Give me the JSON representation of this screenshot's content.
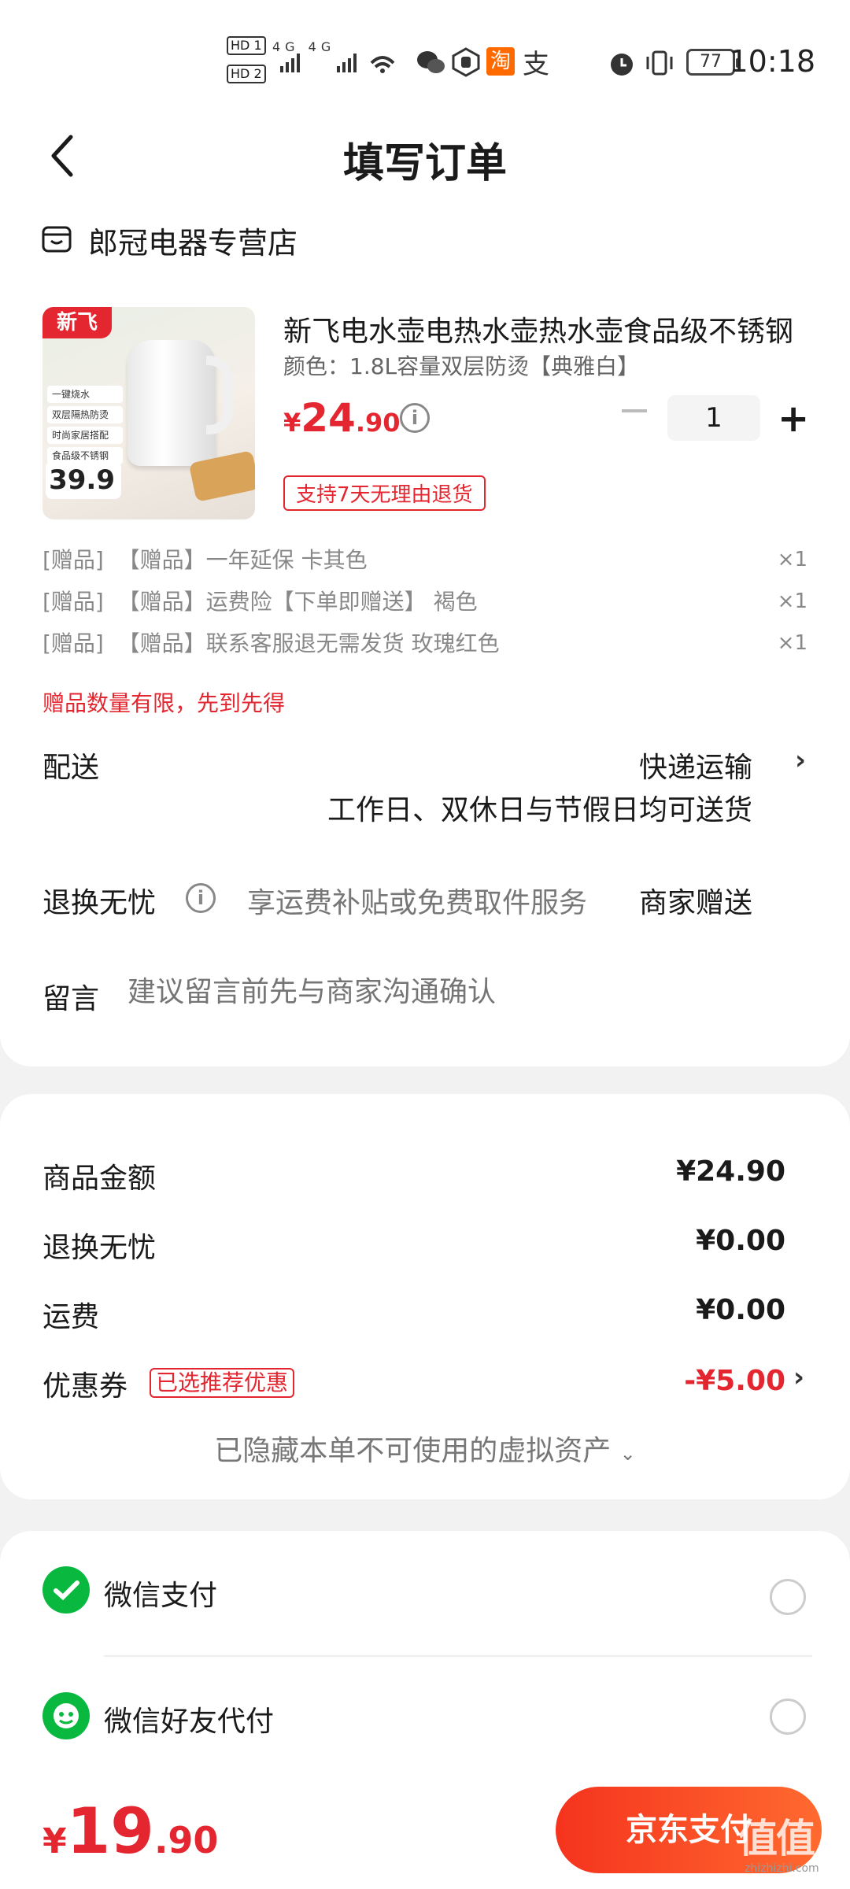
{
  "status_bar": {
    "time": "10:18",
    "battery": "77",
    "hd1": "HD 1",
    "hd2": "HD 2",
    "signal": "4G 4G",
    "alipay": "支",
    "taobao": "淘"
  },
  "header": {
    "title": "填写订单"
  },
  "shop": {
    "name": "郎冠电器专营店"
  },
  "product": {
    "name": "新飞电水壶电热水壶热水壶食品级不锈钢",
    "spec": "颜色：1.8L容量双层防烫【典雅白】",
    "price_currency": "¥",
    "price_int": "24",
    "price_dec": ".90",
    "quantity": "1",
    "returns_badge": "支持7天无理由退货",
    "thumb": {
      "brand": "新飞",
      "features": [
        "一键烧水",
        "双层隔热防烫",
        "时尚家居搭配",
        "食品级不锈钢"
      ],
      "promo_price": "39.9"
    }
  },
  "gifts": [
    {
      "tag": "[赠品]",
      "text": "【赠品】一年延保 卡其色",
      "qty": "×1"
    },
    {
      "tag": "[赠品]",
      "text": "【赠品】运费险【下单即赠送】 褐色",
      "qty": "×1"
    },
    {
      "tag": "[赠品]",
      "text": "【赠品】联系客服退无需发货 玫瑰红色",
      "qty": "×1"
    }
  ],
  "gift_warning": "赠品数量有限，先到先得",
  "delivery": {
    "label": "配送",
    "method": "快递运输",
    "desc": "工作日、双休日与节假日均可送货"
  },
  "return_service": {
    "label": "退换无忧",
    "desc": "享运费补贴或免费取件服务",
    "value": "商家赠送"
  },
  "message": {
    "label": "留言",
    "placeholder": "建议留言前先与商家沟通确认"
  },
  "summary": {
    "goods_label": "商品金额",
    "goods_value": "¥24.90",
    "return_label": "退换无忧",
    "return_value": "¥0.00",
    "shipping_label": "运费",
    "shipping_value": "¥0.00",
    "coupon_label": "优惠券",
    "coupon_tag": "已选推荐优惠",
    "coupon_value": "-¥5.00",
    "hidden_note": "已隐藏本单不可使用的虚拟资产"
  },
  "payment": {
    "wechat_pay": "微信支付",
    "wechat_friend": "微信好友代付"
  },
  "bottom": {
    "total_currency": "¥",
    "total_int": "19",
    "total_dec": ".90",
    "pay_button": "京东支付",
    "watermark": "值值值",
    "watermark_url": "zhizhizhi.com"
  },
  "colors": {
    "accent": "#e3262f",
    "wechat": "#09b83e"
  }
}
